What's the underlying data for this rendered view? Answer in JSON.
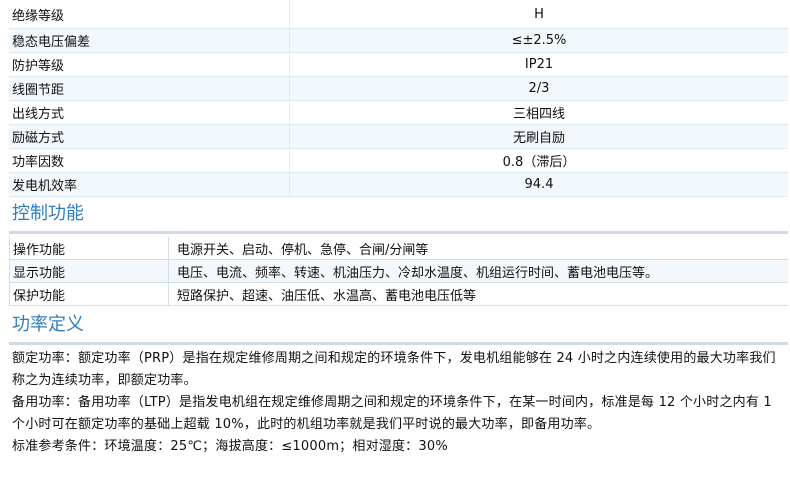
{
  "specs": [
    {
      "label": "绝缘等级",
      "value": "H"
    },
    {
      "label": "稳态电压偏差",
      "value": "≤±2.5%"
    },
    {
      "label": "防护等级",
      "value": "IP21"
    },
    {
      "label": "线圈节距",
      "value": "2/3"
    },
    {
      "label": "出线方式",
      "value": "三相四线"
    },
    {
      "label": "励磁方式",
      "value": "无刷自励"
    },
    {
      "label": "功率因数",
      "value": "0.8（滞后）"
    },
    {
      "label": "发电机效率",
      "value": "94.4"
    }
  ],
  "control_section": {
    "title": "控制功能",
    "rows": [
      {
        "label": "操作功能",
        "value": "电源开关、启动、停机、急停、合闸/分闸等"
      },
      {
        "label": "显示功能",
        "value": "电压、电流、频率、转速、机油压力、冷却水温度、机组运行时间、蓄电池电压等。"
      },
      {
        "label": "保护功能",
        "value": "短路保护、超速、油压低、水温高、蓄电池电压低等"
      }
    ]
  },
  "power_section": {
    "title": "功率定义",
    "paragraphs": [
      "额定功率：额定功率（PRP）是指在规定维修周期之间和规定的环境条件下，发电机组能够在 24 小时之内连续使用的最大功率我们称之为连续功率，即额定功率。",
      "备用功率：备用功率（LTP）是指发电机组在规定维修周期之间和规定的环境条件下，在某一时间内，标准是每 12 个小时之内有 1 个小时可在额定功率的基础上超载 10%，此时的机组功率就是我们平时说的最大功率，即备用功率。",
      "标准参考条件：环境温度：25℃；海拔高度：≤1000m；相对湿度：30%"
    ]
  }
}
